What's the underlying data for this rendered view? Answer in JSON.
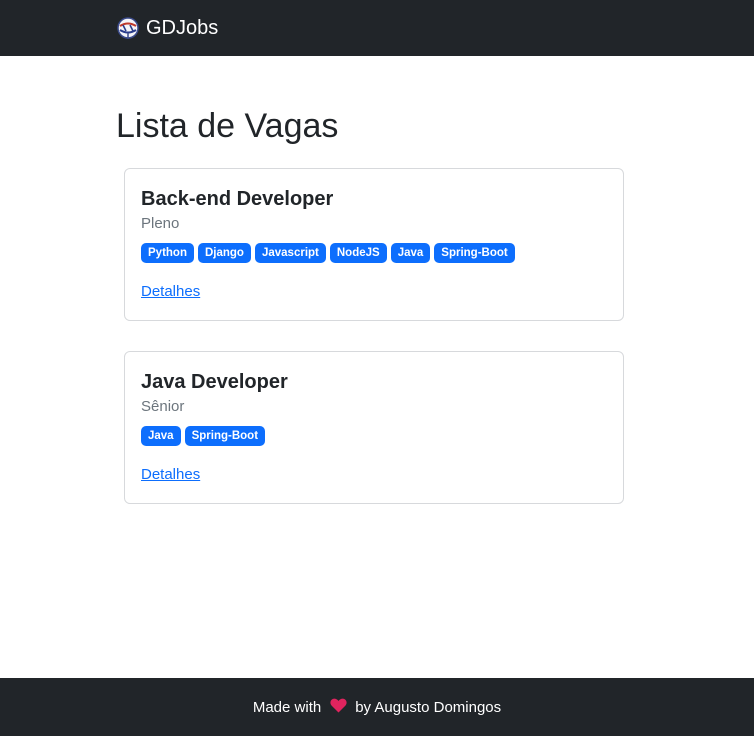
{
  "navbar": {
    "brand": "GDJobs",
    "brand_icon": "gdjobs-logo-icon"
  },
  "page": {
    "title": "Lista de Vagas"
  },
  "jobs": [
    {
      "title": "Back-end Developer",
      "level": "Pleno",
      "tags": [
        "Python",
        "Django",
        "Javascript",
        "NodeJS",
        "Java",
        "Spring-Boot"
      ],
      "link": "Detalhes"
    },
    {
      "title": "Java Developer",
      "level": "Sênior",
      "tags": [
        "Java",
        "Spring-Boot"
      ],
      "link": "Detalhes"
    }
  ],
  "footer": {
    "made_with": "Made with",
    "heart_icon": "heart-icon",
    "by": "by Augusto Domingos"
  },
  "colors": {
    "navbar_bg": "#212529",
    "badge": "#0d6efd",
    "link": "#0d6efd",
    "heart": "#e0245e"
  }
}
